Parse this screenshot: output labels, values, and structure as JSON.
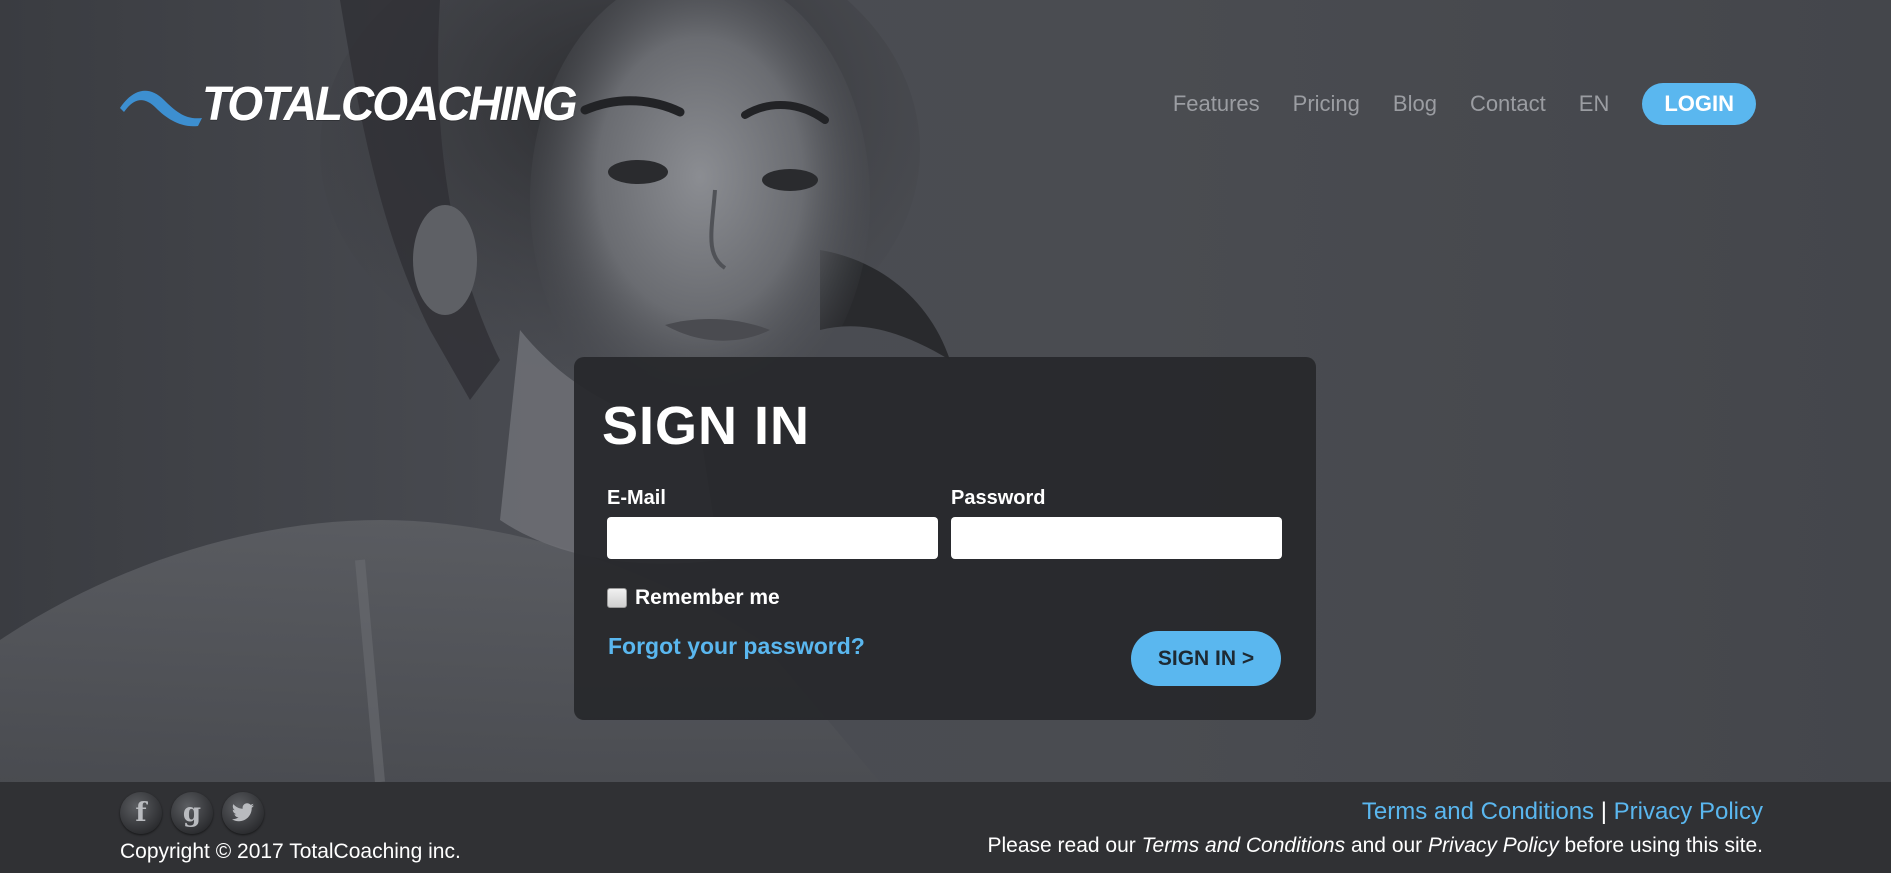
{
  "brand": {
    "name": "TOTALCOACHING",
    "accent_color": "#5ab7ef",
    "logo_swoosh_color": "#3d8fd0"
  },
  "nav": {
    "items": [
      {
        "label": "Features"
      },
      {
        "label": "Pricing"
      },
      {
        "label": "Blog"
      },
      {
        "label": "Contact"
      },
      {
        "label": "EN"
      }
    ],
    "login_label": "LOGIN"
  },
  "signin": {
    "title": "SIGN IN",
    "email_label": "E-Mail",
    "email_value": "",
    "password_label": "Password",
    "password_value": "",
    "remember_label": "Remember me",
    "remember_checked": false,
    "forgot_label": "Forgot your password?",
    "submit_label": "SIGN IN >"
  },
  "footer": {
    "social": [
      {
        "icon": "facebook-icon",
        "glyph": "f"
      },
      {
        "icon": "google-plus-icon",
        "glyph": "g"
      },
      {
        "icon": "twitter-icon",
        "glyph": "t"
      }
    ],
    "copyright": "Copyright © 2017 TotalCoaching inc.",
    "terms_label": "Terms and Conditions",
    "separator": "|",
    "privacy_label": "Privacy Policy",
    "note_prefix": "Please read our ",
    "note_terms": "Terms and Conditions",
    "note_middle": " and our ",
    "note_privacy": "Privacy Policy",
    "note_suffix": " before using this site."
  }
}
